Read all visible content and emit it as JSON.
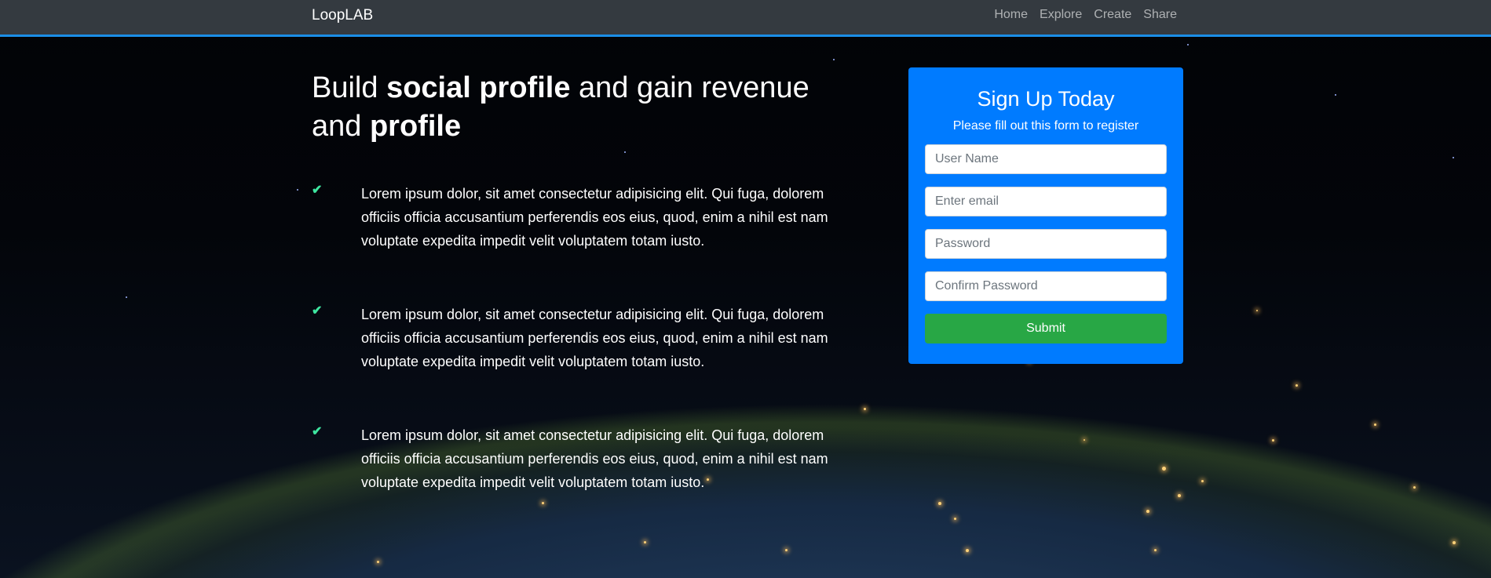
{
  "navbar": {
    "brand": "LoopLAB",
    "links": [
      "Home",
      "Explore",
      "Create",
      "Share"
    ]
  },
  "hero": {
    "title_parts": [
      "Build ",
      "social profile",
      " and gain revenue and ",
      "profile"
    ]
  },
  "features": [
    {
      "icon": "check-icon",
      "text": "Lorem ipsum dolor, sit amet consectetur adipisicing elit. Qui fuga, dolorem officiis officia accusantium perferendis eos eius, quod, enim a nihil est nam voluptate expedita impedit velit voluptatem totam iusto."
    },
    {
      "icon": "check-icon",
      "text": "Lorem ipsum dolor, sit amet consectetur adipisicing elit. Qui fuga, dolorem officiis officia accusantium perferendis eos eius, quod, enim a nihil est nam voluptate expedita impedit velit voluptatem totam iusto."
    },
    {
      "icon": "check-icon",
      "text": "Lorem ipsum dolor, sit amet consectetur adipisicing elit. Qui fuga, dolorem officiis officia accusantium perferendis eos eius, quod, enim a nihil est nam voluptate expedita impedit velit voluptatem totam iusto."
    }
  ],
  "signup": {
    "title": "Sign Up Today",
    "subtitle": "Please fill out this form to register",
    "username_placeholder": "User Name",
    "email_placeholder": "Enter email",
    "password_placeholder": "Password",
    "confirm_placeholder": "Confirm Password",
    "submit_label": "Submit"
  },
  "colors": {
    "navbar": "#343a40",
    "navbar_border": "#1b8ee6",
    "card": "#007bff",
    "submit": "#28a745",
    "check": "#3ee6a0"
  }
}
